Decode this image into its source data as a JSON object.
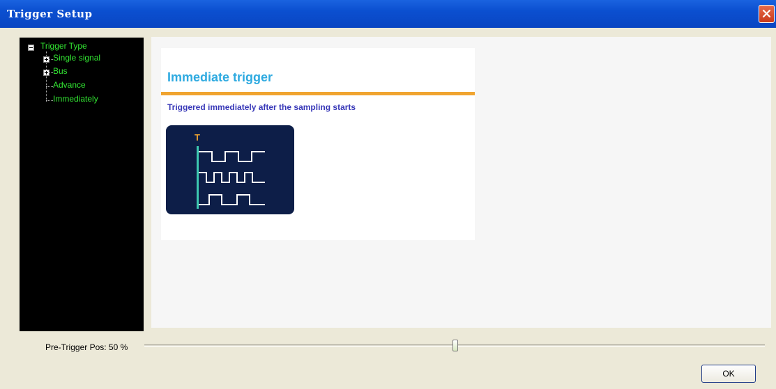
{
  "window": {
    "title": "Trigger Setup"
  },
  "tree": {
    "root_label": "Trigger Type",
    "items": [
      {
        "label": "Single signal"
      },
      {
        "label": "Bus"
      },
      {
        "label": "Advance"
      },
      {
        "label": "Immediately"
      }
    ]
  },
  "content": {
    "title": "Immediate trigger",
    "description": "Triggered immediately after the sampling starts",
    "diagram_marker": "T"
  },
  "slider": {
    "label": "Pre-Trigger Pos: 50 %",
    "value_percent": 50
  },
  "buttons": {
    "ok_label": "OK"
  },
  "colors": {
    "titlebar": "#0b4fd0",
    "tree_text": "#32e632",
    "card_title": "#2eaae0",
    "accent_rule": "#f0a430",
    "description": "#3838b8",
    "diagram_bg": "#0d1e48",
    "trigger_line": "#3cc8b0"
  },
  "icons": [
    "close-icon",
    "collapse-icon",
    "expand-icon"
  ]
}
